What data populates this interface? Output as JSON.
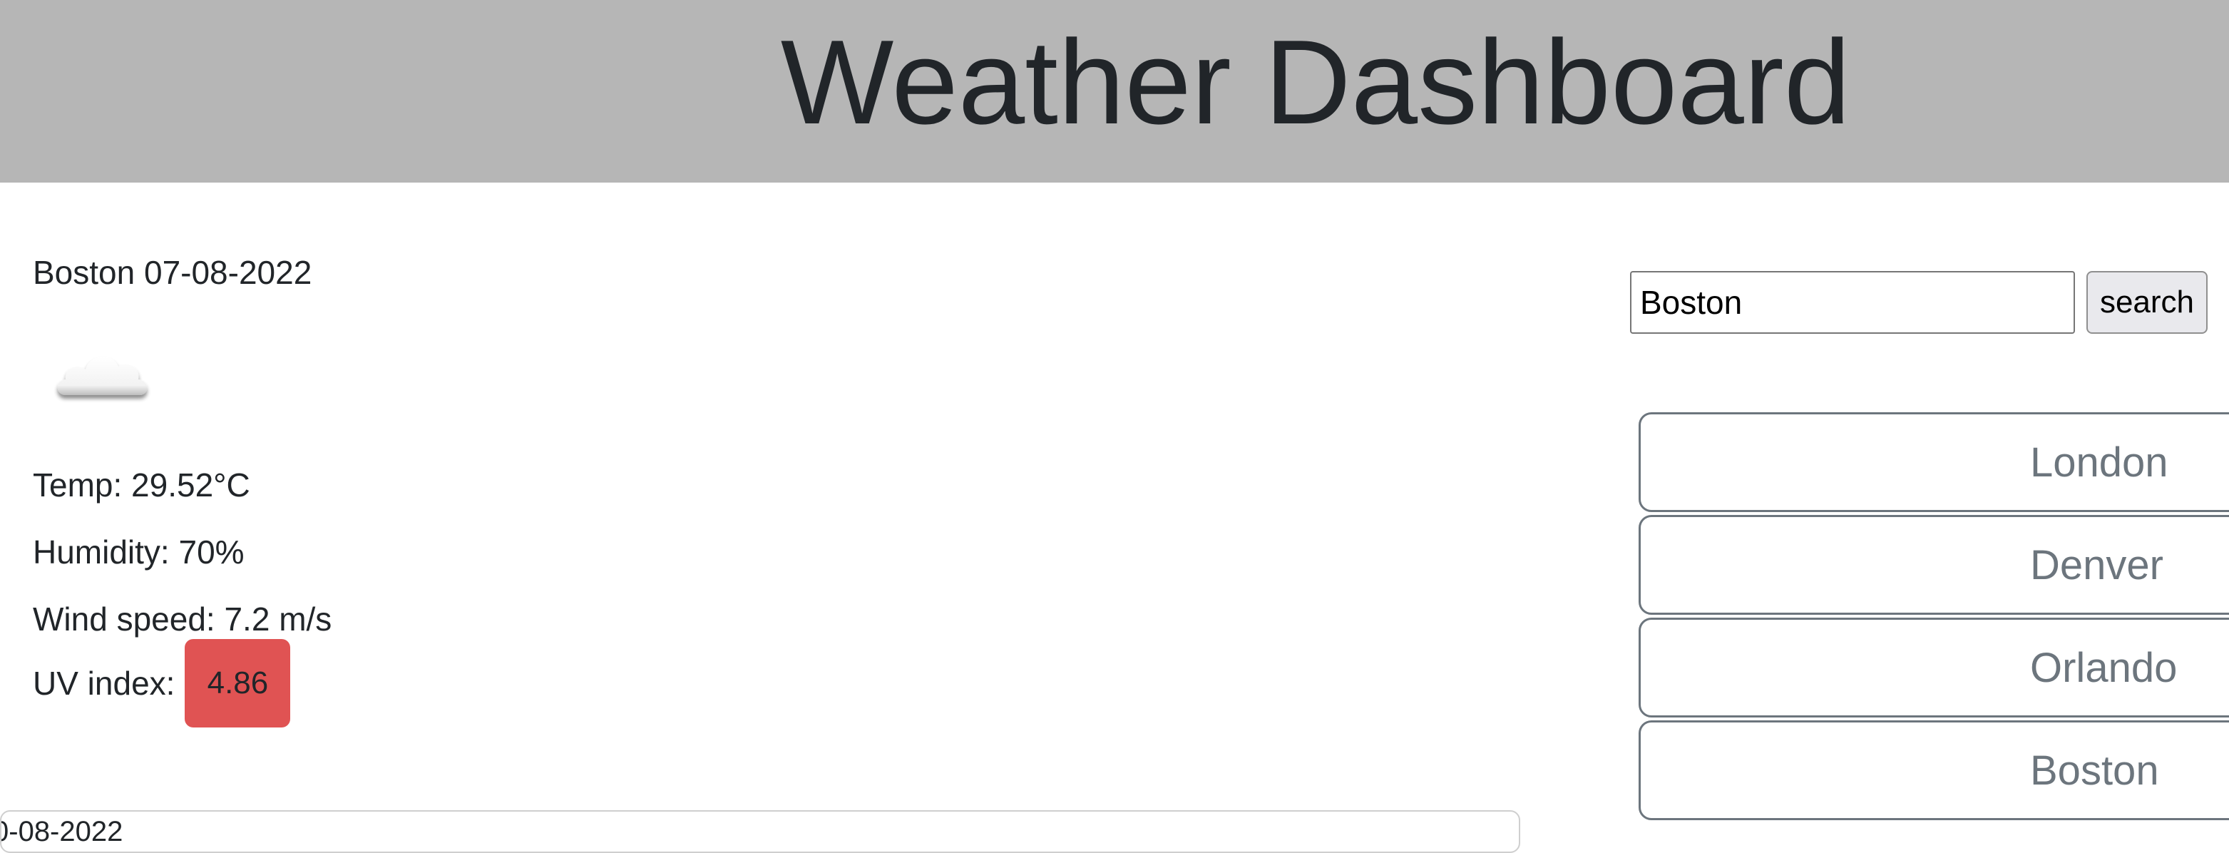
{
  "header": {
    "title": "Weather Dashboard"
  },
  "current": {
    "city_date": "Boston 07-08-2022",
    "icon": "cloud-icon",
    "temp": "Temp: 29.52°C",
    "humidity": "Humidity: 70%",
    "wind": "Wind speed: 7.2 m/s",
    "uv_label": "UV index:",
    "uv_value": "4.86",
    "uv_color": "#e05353"
  },
  "forecast": {
    "partial_text": "0-08-2022"
  },
  "search": {
    "value": "Boston",
    "button_label": "search"
  },
  "history": {
    "items": [
      {
        "label": "London"
      },
      {
        "label": "Denver"
      },
      {
        "label": "Orlando"
      },
      {
        "label": "Boston"
      }
    ]
  },
  "colors": {
    "header_bg": "#b6b6b6",
    "history_border": "#6c757d"
  }
}
